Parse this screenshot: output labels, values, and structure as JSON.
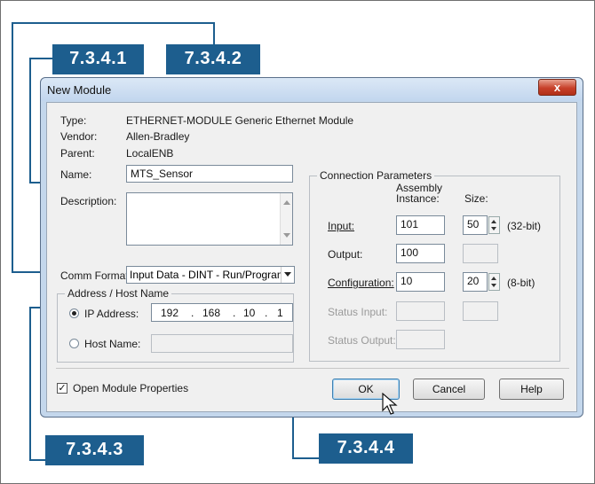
{
  "callouts": {
    "c1": "7.3.4.1",
    "c2": "7.3.4.2",
    "c3": "7.3.4.3",
    "c4": "7.3.4.4"
  },
  "dialog": {
    "title": "New Module",
    "close_label": "x",
    "type_label": "Type:",
    "type_value": "ETHERNET-MODULE Generic Ethernet Module",
    "vendor_label": "Vendor:",
    "vendor_value": "Allen-Bradley",
    "parent_label": "Parent:",
    "parent_value": "LocalENB",
    "name_label": "Name:",
    "name_value": "MTS_Sensor",
    "description_label": "Description:",
    "description_value": "",
    "comm_format_label": "Comm Format:",
    "comm_format_value": "Input Data - DINT - Run/Program",
    "address_group_title": "Address / Host Name",
    "ip_address_label": "IP Address:",
    "ip_address": [
      "192",
      "168",
      "10",
      "1"
    ],
    "host_name_label": "Host Name:",
    "host_name_value": "",
    "open_module_properties_label": "Open Module Properties",
    "open_module_properties_checked": true,
    "ok_label": "OK",
    "cancel_label": "Cancel",
    "help_label": "Help"
  },
  "connection": {
    "group_title": "Connection Parameters",
    "assembly_header_1": "Assembly",
    "assembly_header_2": "Instance:",
    "size_header": "Size:",
    "input_label": "Input:",
    "input_instance": "101",
    "input_size": "50",
    "input_unit": "(32-bit)",
    "output_label": "Output:",
    "output_instance": "100",
    "output_size": "",
    "configuration_label": "Configuration:",
    "configuration_instance": "10",
    "configuration_size": "20",
    "configuration_unit": "(8-bit)",
    "status_input_label": "Status Input:",
    "status_output_label": "Status Output:"
  },
  "colors": {
    "callout": "#1d5e8e",
    "dialog_frame": "#c4d7ec",
    "close_button": "#c7402a"
  }
}
